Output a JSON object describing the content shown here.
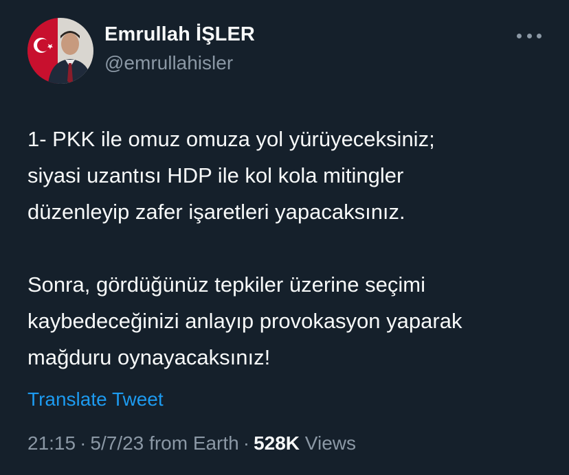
{
  "author": {
    "display_name": "Emrullah İŞLER",
    "handle": "@emrullahisler"
  },
  "more_icon": "more-horizontal-icon",
  "tweet": {
    "paragraphs": [
      {
        "lines": [
          "1- PKK ile omuz omuza yol yürüyeceksiniz;",
          "siyasi uzantısı HDP ile kol kola mitingler",
          "düzenleyip zafer işaretleri yapacaksınız."
        ]
      },
      {
        "lines": [
          "Sonra, gördüğünüz tepkiler üzerine seçimi",
          "kaybedeceğinizi anlayıp provokasyon yaparak",
          "mağduru oynayacaksınız!"
        ]
      }
    ]
  },
  "translate_label": "Translate Tweet",
  "meta": {
    "time": "21:15",
    "separator": "·",
    "date_source": "5/7/23 from Earth",
    "views_count": "528K",
    "views_label": "Views"
  },
  "colors": {
    "background": "#15202b",
    "primary_text": "#f7f9f9",
    "secondary_text": "#8b98a5",
    "link": "#1d9bf0"
  }
}
